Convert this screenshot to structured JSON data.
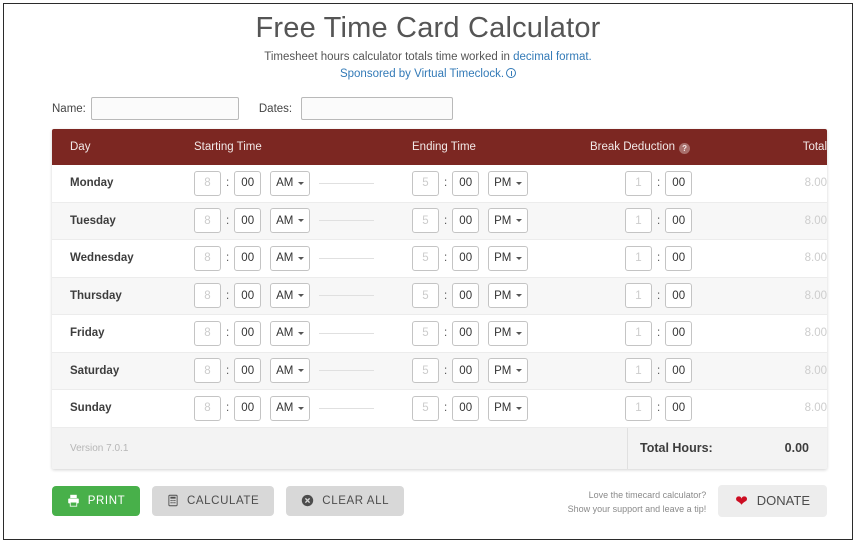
{
  "page": {
    "title": "Free Time Card Calculator",
    "subtitle_pre": "Timesheet hours calculator totals time worked in ",
    "subtitle_link": "decimal format.",
    "sponsor_text": "Sponsored by Virtual Timeclock.",
    "info_icon": "info-circle-icon"
  },
  "form": {
    "name_label": "Name:",
    "name_value": "",
    "dates_label": "Dates:",
    "dates_value": ""
  },
  "table": {
    "headers": {
      "day": "Day",
      "starting_time": "Starting Time",
      "ending_time": "Ending Time",
      "break_deduction": "Break Deduction",
      "break_help_icon": "?",
      "total": "Total"
    },
    "defaults": {
      "start_hour_placeholder": "8",
      "start_minute_value": "00",
      "start_meridiem": "AM",
      "end_hour_placeholder": "5",
      "end_minute_value": "00",
      "end_meridiem": "PM",
      "break_hour_placeholder": "1",
      "break_minute_value": "00",
      "row_total": "8.00",
      "colon": ":"
    },
    "rows": [
      {
        "day": "Monday"
      },
      {
        "day": "Tuesday"
      },
      {
        "day": "Wednesday"
      },
      {
        "day": "Thursday"
      },
      {
        "day": "Friday"
      },
      {
        "day": "Saturday"
      },
      {
        "day": "Sunday"
      }
    ],
    "footer": {
      "version": "Version 7.0.1",
      "total_hours_label": "Total Hours:",
      "total_hours_value": "0.00"
    }
  },
  "actions": {
    "print": {
      "label": "PRINT",
      "icon": "printer-icon"
    },
    "calculate": {
      "label": "CALCULATE",
      "icon": "calculator-icon"
    },
    "clear_all": {
      "label": "CLEAR ALL",
      "icon": "circle-x-icon"
    }
  },
  "donate": {
    "line1": "Love the timecard calculator?",
    "line2": "Show your support and leave a tip!",
    "button_label": "DONATE",
    "icon": "heart-icon"
  },
  "colors": {
    "header_bar": "#7c2722",
    "link": "#337ab7",
    "print_green": "#48b04a",
    "heart_red": "#cc0d22"
  }
}
